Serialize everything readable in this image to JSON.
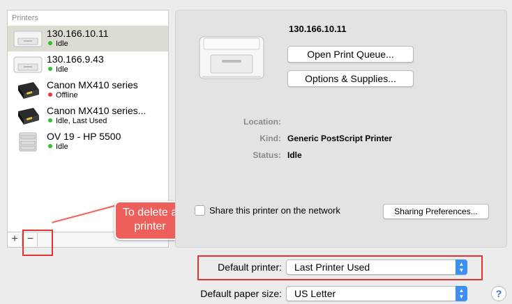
{
  "printers_pane": {
    "header": "Printers",
    "items": [
      {
        "name": "130.166.10.11",
        "status": "Idle",
        "status_color": "#2fbf2f",
        "icon": "generic-printer-icon",
        "selected": true
      },
      {
        "name": "130.166.9.43",
        "status": "Idle",
        "status_color": "#2fbf2f",
        "icon": "generic-printer-icon",
        "selected": false
      },
      {
        "name": "Canon MX410 series",
        "status": "Offline",
        "status_color": "#e23b3b",
        "icon": "canon-printer-icon",
        "selected": false
      },
      {
        "name": "Canon MX410 series...",
        "status": "Idle, Last Used",
        "status_color": "#2fbf2f",
        "icon": "canon-printer-icon",
        "selected": false
      },
      {
        "name": "OV 19 - HP 5500",
        "status": "Idle",
        "status_color": "#2fbf2f",
        "icon": "hp-printer-icon",
        "selected": false
      }
    ],
    "add_label": "+",
    "remove_label": "−"
  },
  "annotation": {
    "callout_text": "To delete a printer",
    "color": "#ec5f5b"
  },
  "detail": {
    "title": "130.166.10.11",
    "open_queue_label": "Open Print Queue...",
    "options_label": "Options & Supplies...",
    "location_label": "Location:",
    "location_value": "",
    "kind_label": "Kind:",
    "kind_value": "Generic PostScript Printer",
    "status_label": "Status:",
    "status_value": "Idle",
    "share_label": "Share this printer on the network",
    "share_checked": false,
    "sharing_prefs_label": "Sharing Preferences..."
  },
  "defaults": {
    "printer_label": "Default printer:",
    "printer_value": "Last Printer Used",
    "paper_label": "Default paper size:",
    "paper_value": "US Letter",
    "help_label": "?"
  }
}
